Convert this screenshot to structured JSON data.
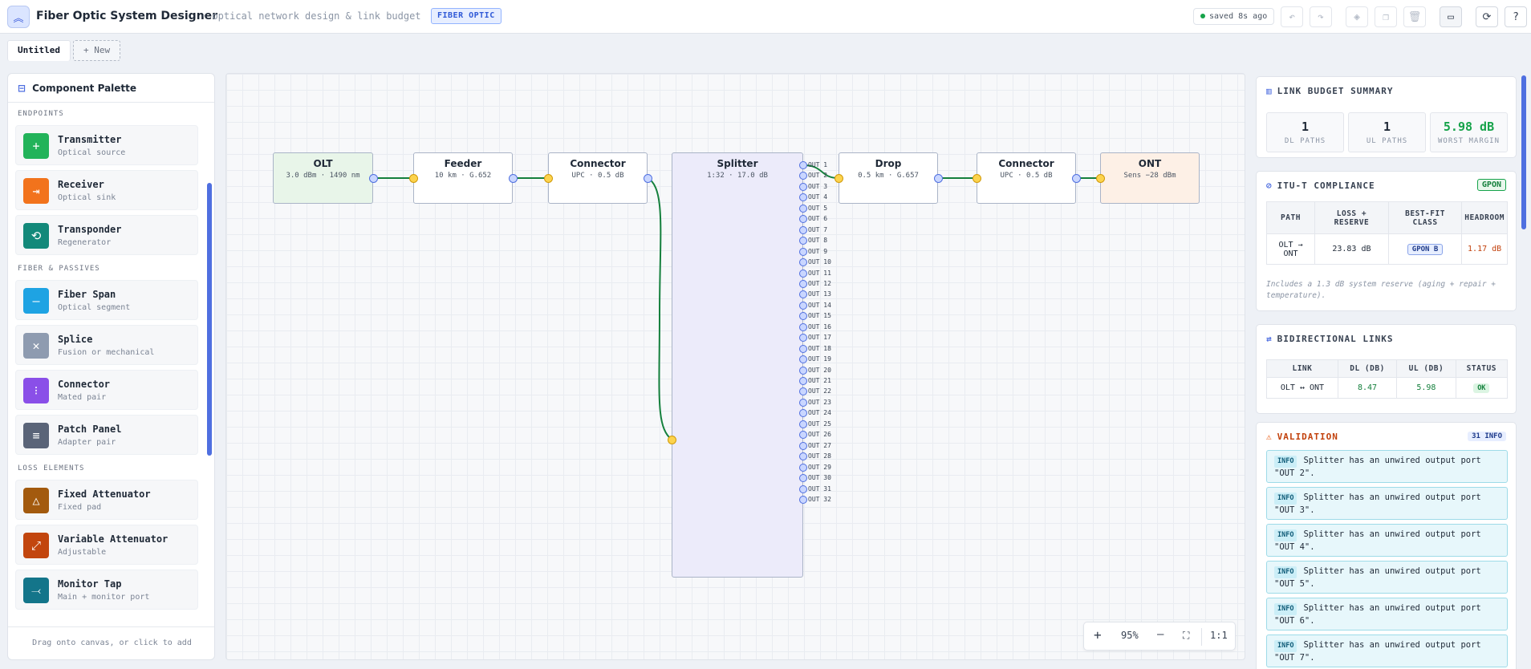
{
  "app": {
    "title": "Fiber Optic System Designer",
    "subtitle": "· optical network design & link budget",
    "badge": "FIBER OPTIC",
    "saved": "saved 8s ago"
  },
  "toolbar": [
    "undo-icon",
    "redo-icon",
    "layers-icon",
    "copy-icon",
    "trash-icon",
    "folder-icon",
    "refresh-icon",
    "help-icon"
  ],
  "tabs": {
    "active": "Untitled",
    "new": "+ New"
  },
  "palette": {
    "title": "Component Palette",
    "footer": "Drag onto canvas, or click to add",
    "sections": [
      {
        "name": "ENDPOINTS",
        "items": [
          {
            "name": "Transmitter",
            "desc": "Optical source",
            "color": "#22b35a",
            "glyph": "+"
          },
          {
            "name": "Receiver",
            "desc": "Optical sink",
            "color": "#f2731c",
            "glyph": "⇥"
          },
          {
            "name": "Transponder",
            "desc": "Regenerator",
            "color": "#13897a",
            "glyph": "⟲"
          }
        ]
      },
      {
        "name": "FIBER & PASSIVES",
        "items": [
          {
            "name": "Fiber Span",
            "desc": "Optical segment",
            "color": "#1ea3e3",
            "glyph": "—"
          },
          {
            "name": "Splice",
            "desc": "Fusion or mechanical",
            "color": "#8e9bb0",
            "glyph": "✕"
          },
          {
            "name": "Connector",
            "desc": "Mated pair",
            "color": "#8a4fe8",
            "glyph": "⁝"
          },
          {
            "name": "Patch Panel",
            "desc": "Adapter pair",
            "color": "#5a6478",
            "glyph": "≡"
          }
        ]
      },
      {
        "name": "LOSS ELEMENTS",
        "items": [
          {
            "name": "Fixed Attenuator",
            "desc": "Fixed pad",
            "color": "#a35a0e",
            "glyph": "△"
          },
          {
            "name": "Variable Attenuator",
            "desc": "Adjustable",
            "color": "#c2460e",
            "glyph": "⤢"
          },
          {
            "name": "Monitor Tap",
            "desc": "Main + monitor port",
            "color": "#13758a",
            "glyph": "⤙"
          }
        ]
      }
    ]
  },
  "nodes": [
    {
      "title": "OLT",
      "sub": "3.0 dBm · 1490 nm",
      "fill": "#e8f5e9"
    },
    {
      "title": "Feeder",
      "sub": "10 km · G.652",
      "fill": "#ffffff"
    },
    {
      "title": "Connector",
      "sub": "UPC · 0.5 dB",
      "fill": "#ffffff"
    },
    {
      "title": "Splitter",
      "sub": "1:32 · 17.0 dB",
      "fill": "#ecebfa"
    },
    {
      "title": "Drop",
      "sub": "0.5 km · G.657",
      "fill": "#ffffff"
    },
    {
      "title": "Connector",
      "sub": "UPC · 0.5 dB",
      "fill": "#ffffff"
    },
    {
      "title": "ONT",
      "sub": "Sens −28 dBm",
      "fill": "#fdf0e6"
    }
  ],
  "splitter_outputs": [
    "OUT 1",
    "OUT 2",
    "OUT 3",
    "OUT 4",
    "OUT 5",
    "OUT 6",
    "OUT 7",
    "OUT 8",
    "OUT 9",
    "OUT 10",
    "OUT 11",
    "OUT 12",
    "OUT 13",
    "OUT 14",
    "OUT 15",
    "OUT 16",
    "OUT 17",
    "OUT 18",
    "OUT 19",
    "OUT 20",
    "OUT 21",
    "OUT 22",
    "OUT 23",
    "OUT 24",
    "OUT 25",
    "OUT 26",
    "OUT 27",
    "OUT 28",
    "OUT 29",
    "OUT 30",
    "OUT 31",
    "OUT 32"
  ],
  "zoom": {
    "level": "95%",
    "reset": "1:1"
  },
  "summary": {
    "title": "LINK BUDGET SUMMARY",
    "dl": "1",
    "dl_label": "DL PATHS",
    "ul": "1",
    "ul_label": "UL PATHS",
    "margin": "5.98 dB",
    "margin_label": "WORST MARGIN"
  },
  "itu": {
    "title": "ITU-T COMPLIANCE",
    "badge": "GPON",
    "headers": [
      "PATH",
      "LOSS + RESERVE",
      "BEST-FIT CLASS",
      "HEADROOM"
    ],
    "row": {
      "path": "OLT → ONT",
      "loss": "23.83 dB",
      "cls": "GPON B",
      "headroom": "1.17 dB"
    },
    "note": "Includes a 1.3 dB system reserve (aging + repair + temperature)."
  },
  "bidir": {
    "title": "BIDIRECTIONAL LINKS",
    "headers": [
      "LINK",
      "DL (DB)",
      "UL (DB)",
      "STATUS"
    ],
    "row": {
      "link": "OLT ↔ ONT",
      "dl": "8.47",
      "ul": "5.98",
      "status": "OK"
    }
  },
  "validation": {
    "title": "VALIDATION",
    "badge": "31 INFO",
    "tag": "INFO",
    "messages": [
      "Splitter has an unwired output port \"OUT 2\".",
      "Splitter has an unwired output port \"OUT 3\".",
      "Splitter has an unwired output port \"OUT 4\".",
      "Splitter has an unwired output port \"OUT 5\".",
      "Splitter has an unwired output port \"OUT 6\".",
      "Splitter has an unwired output port \"OUT 7\"."
    ]
  }
}
